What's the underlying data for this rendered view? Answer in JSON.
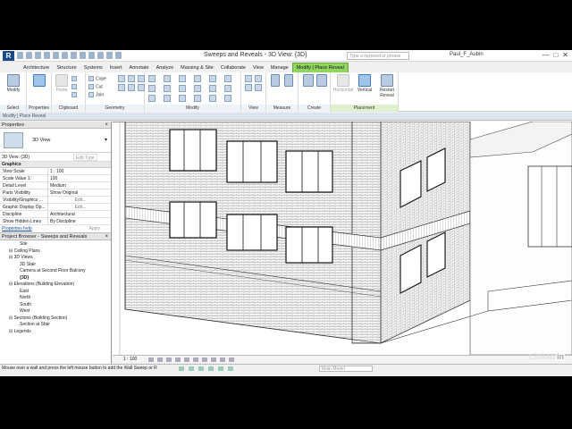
{
  "window": {
    "title": "Sweeps and Reveals - 3D View: {3D}",
    "logo": "R",
    "search_placeholder": "Type a keyword or phrase",
    "user": "Paul_F_Aubin",
    "controls": [
      "—",
      "□",
      "✕"
    ]
  },
  "tabs": [
    {
      "label": "",
      "kind": "file"
    },
    {
      "label": "Architecture",
      "kind": "normal"
    },
    {
      "label": "Structure",
      "kind": "normal"
    },
    {
      "label": "Systems",
      "kind": "normal"
    },
    {
      "label": "Insert",
      "kind": "normal"
    },
    {
      "label": "Annotate",
      "kind": "normal"
    },
    {
      "label": "Analyze",
      "kind": "normal"
    },
    {
      "label": "Massing & Site",
      "kind": "normal"
    },
    {
      "label": "Collaborate",
      "kind": "normal"
    },
    {
      "label": "View",
      "kind": "normal"
    },
    {
      "label": "Manage",
      "kind": "normal"
    },
    {
      "label": "Modify | Place Reveal",
      "kind": "ctx"
    }
  ],
  "ribbon": {
    "select_label": "Select",
    "properties_label": "Properties",
    "clipboard_label": "Clipboard",
    "geometry_label": "Geometry",
    "modify_label": "Modify",
    "view_label": "View",
    "measure_label": "Measure",
    "create_label": "Create",
    "placement_label": "Placement",
    "buttons": {
      "modify": "Modify",
      "paste": "Paste",
      "cope": "Cope",
      "cut": "Cut",
      "join": "Join",
      "horizontal": "Horizontal",
      "vertical": "Vertical",
      "restart_reveal": "Restart Reveal"
    }
  },
  "context_bar": "Modify | Place Reveal",
  "properties": {
    "header": "Properties",
    "type_name": "3D View",
    "selector": "3D View: {3D}",
    "edit_type": "Edit Type",
    "group": "Graphics",
    "rows": [
      {
        "k": "View Scale",
        "v": "1 : 100"
      },
      {
        "k": "Scale Value    1:",
        "v": "100"
      },
      {
        "k": "Detail Level",
        "v": "Medium"
      },
      {
        "k": "Parts Visibility",
        "v": "Show Original"
      },
      {
        "k": "Visibility/Graphics ...",
        "v": "Edit..."
      },
      {
        "k": "Graphic Display Op...",
        "v": "Edit..."
      },
      {
        "k": "Discipline",
        "v": "Architectural"
      },
      {
        "k": "Show Hidden Lines",
        "v": "By Discipline"
      }
    ],
    "help": "Properties help",
    "apply": "Apply"
  },
  "browser": {
    "header": "Project Browser - Sweeps and Reveals",
    "items": [
      {
        "text": "Site",
        "indent": 3
      },
      {
        "text": "Ceiling Plans",
        "indent": 1
      },
      {
        "text": "3D Views",
        "indent": 1
      },
      {
        "text": "3D Stair",
        "indent": 3
      },
      {
        "text": "Camera at Second Floor Balcony",
        "indent": 3
      },
      {
        "text": "{3D}",
        "indent": 3
      },
      {
        "text": "Elevations (Building Elevation)",
        "indent": 1
      },
      {
        "text": "East",
        "indent": 3
      },
      {
        "text": "North",
        "indent": 3
      },
      {
        "text": "South",
        "indent": 3
      },
      {
        "text": "West",
        "indent": 3
      },
      {
        "text": "Sections (Building Section)",
        "indent": 1
      },
      {
        "text": "Section at Stair",
        "indent": 3
      },
      {
        "text": "Legends",
        "indent": 1
      }
    ]
  },
  "view_bar": {
    "scale": "1 : 100"
  },
  "status": {
    "message": "Mouse over a wall and press the left mouse button to add the Wall Sweep or R",
    "model": "Main Model"
  },
  "watermark": {
    "text": "Linked",
    "box": "in"
  }
}
